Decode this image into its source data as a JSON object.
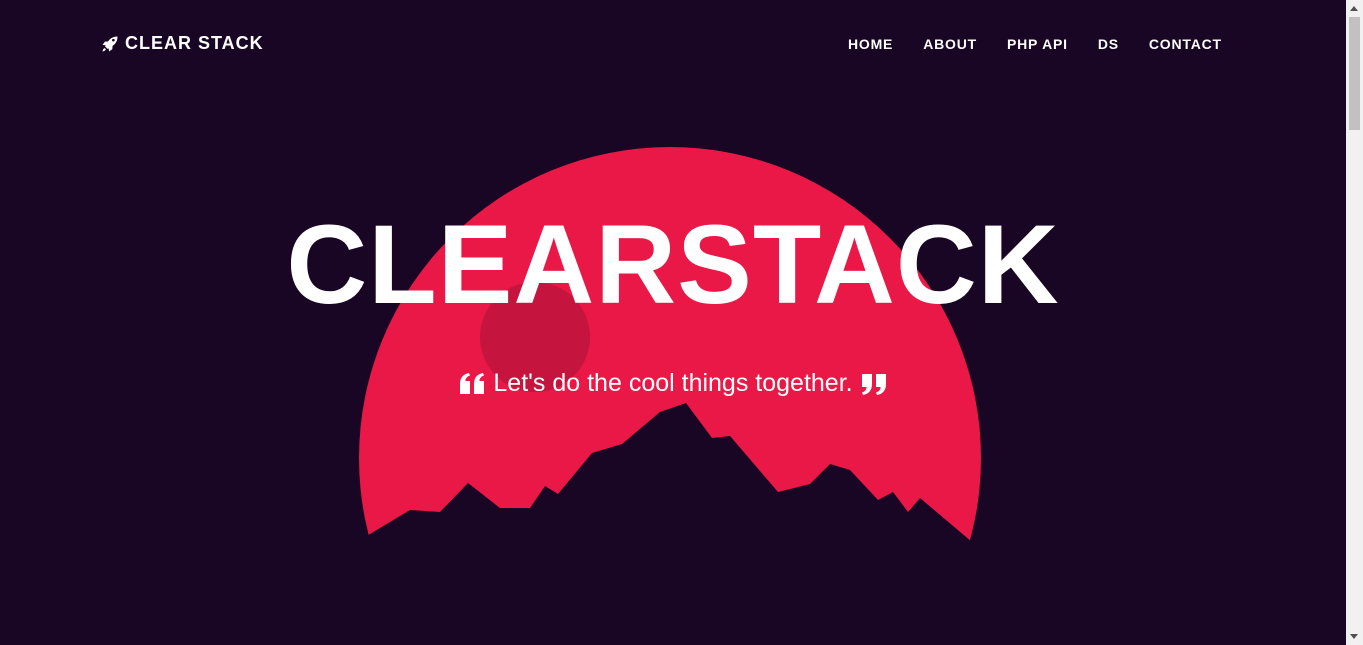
{
  "brand": {
    "name": "CLEAR STACK",
    "icon": "rocket-icon"
  },
  "nav": {
    "items": [
      {
        "label": "HOME"
      },
      {
        "label": "ABOUT"
      },
      {
        "label": "PHP API"
      },
      {
        "label": "DS"
      },
      {
        "label": "CONTACT"
      }
    ]
  },
  "hero": {
    "title": "CLEARSTACK",
    "tagline": "Let's do the cool things together.",
    "open_quote_icon": "quote-left-icon",
    "close_quote_icon": "quote-right-icon"
  },
  "colors": {
    "background": "#190624",
    "sun": "#e91846",
    "sun_spot": "#c5143d",
    "text": "#ffffff"
  }
}
